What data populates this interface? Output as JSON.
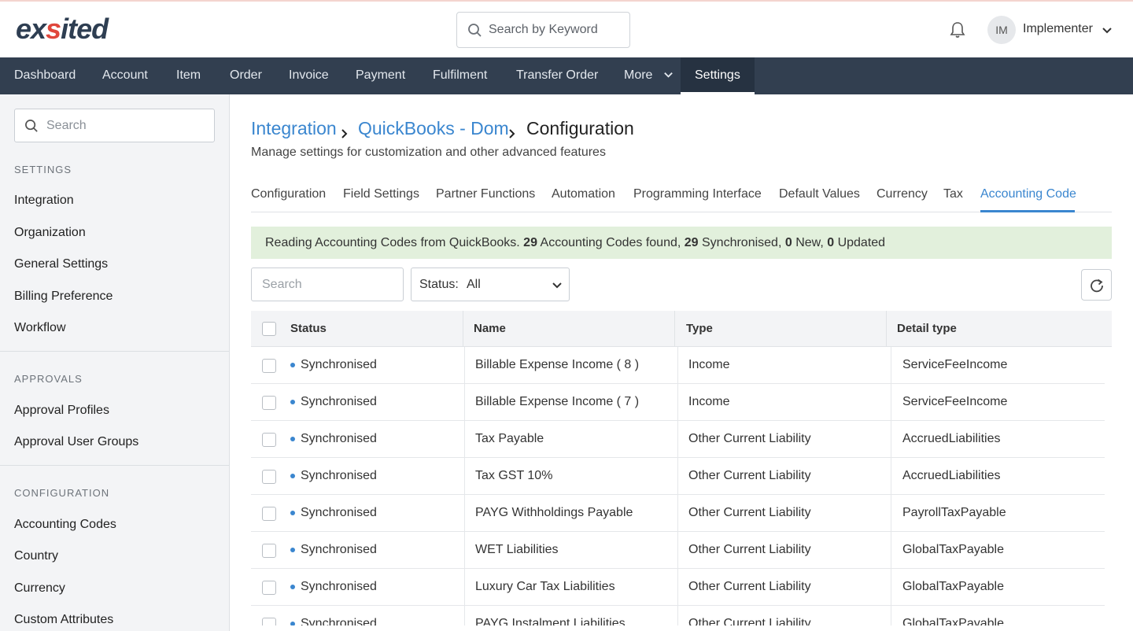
{
  "header": {
    "logo_prefix": "ex",
    "logo_accent": "s",
    "logo_suffix": "ited",
    "search_placeholder": "Search by Keyword",
    "avatar_initials": "IM",
    "user_name": "Implementer"
  },
  "nav": {
    "items": [
      "Dashboard",
      "Account",
      "Item",
      "Order",
      "Invoice",
      "Payment",
      "Fulfilment",
      "Transfer Order",
      "More",
      "Settings"
    ]
  },
  "sidebar": {
    "search_placeholder": "Search",
    "sections": [
      {
        "heading": "SETTINGS",
        "items": [
          "Integration",
          "Organization",
          "General Settings",
          "Billing Preference",
          "Workflow"
        ]
      },
      {
        "heading": "APPROVALS",
        "items": [
          "Approval Profiles",
          "Approval User Groups"
        ]
      },
      {
        "heading": "CONFIGURATION",
        "items": [
          "Accounting Codes",
          "Country",
          "Currency",
          "Custom Attributes"
        ]
      }
    ]
  },
  "breadcrumb": {
    "items": [
      "Integration",
      "QuickBooks - Dom"
    ],
    "current": "Configuration"
  },
  "subtitle": "Manage settings for customization and other advanced features",
  "tabs": [
    "Configuration",
    "Field Settings",
    "Partner Functions",
    "Automation",
    "Programming Interface",
    "Default Values",
    "Currency",
    "Tax",
    "Accounting Code"
  ],
  "active_tab": "Accounting Code",
  "banner": {
    "prefix": "Reading Accounting Codes from QuickBooks. ",
    "found": "29",
    "found_label": " Accounting Codes found, ",
    "synced": "29",
    "synced_label": " Synchronised, ",
    "new": "0",
    "new_label": " New, ",
    "updated": "0",
    "updated_label": " Updated"
  },
  "filters": {
    "search_placeholder": "Search",
    "status_label": "Status:",
    "status_value": "All"
  },
  "table": {
    "columns": [
      "Status",
      "Name",
      "Type",
      "Detail type"
    ],
    "rows": [
      {
        "status": "Synchronised",
        "name": "Billable Expense Income ( 8 )",
        "type": "Income",
        "detail": "ServiceFeeIncome"
      },
      {
        "status": "Synchronised",
        "name": "Billable Expense Income ( 7 )",
        "type": "Income",
        "detail": "ServiceFeeIncome"
      },
      {
        "status": "Synchronised",
        "name": "Tax Payable",
        "type": "Other Current Liability",
        "detail": "AccruedLiabilities"
      },
      {
        "status": "Synchronised",
        "name": "Tax GST 10%",
        "type": "Other Current Liability",
        "detail": "AccruedLiabilities"
      },
      {
        "status": "Synchronised",
        "name": "PAYG Withholdings Payable",
        "type": "Other Current Liability",
        "detail": "PayrollTaxPayable"
      },
      {
        "status": "Synchronised",
        "name": "WET Liabilities",
        "type": "Other Current Liability",
        "detail": "GlobalTaxPayable"
      },
      {
        "status": "Synchronised",
        "name": "Luxury Car Tax Liabilities",
        "type": "Other Current Liability",
        "detail": "GlobalTaxPayable"
      },
      {
        "status": "Synchronised",
        "name": "PAYG Instalment Liabilities",
        "type": "Other Current Liability",
        "detail": "GlobalTaxPayable"
      }
    ]
  },
  "colors": {
    "accent": "#3a86cf",
    "nav_bg": "#323f50",
    "banner_bg": "#e2f0dc",
    "logo_dark": "#2e3e52",
    "logo_red": "#e0473c"
  },
  "icons": {
    "search": "search-icon",
    "bell": "bell-icon",
    "chevron": "chevron-down-icon",
    "refresh": "refresh-icon"
  }
}
